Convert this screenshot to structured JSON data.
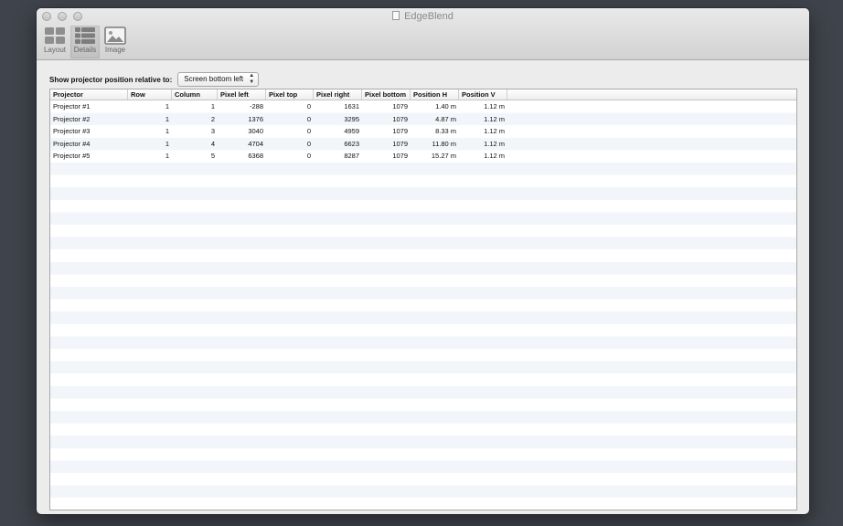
{
  "window": {
    "title": "EdgeBlend"
  },
  "toolbar": {
    "items": [
      {
        "label": "Layout",
        "icon": "layout-grid-icon"
      },
      {
        "label": "Details",
        "icon": "details-list-icon"
      },
      {
        "label": "Image",
        "icon": "image-icon"
      }
    ]
  },
  "relative": {
    "label": "Show projector position relative to:",
    "selected": "Screen bottom left"
  },
  "table": {
    "columns": [
      "Projector",
      "Row",
      "Column",
      "Pixel left",
      "Pixel top",
      "Pixel right",
      "Pixel bottom",
      "Position H",
      "Position V"
    ],
    "rows": [
      [
        "Projector #1",
        "1",
        "1",
        "-288",
        "0",
        "1631",
        "1079",
        "1.40 m",
        "1.12 m"
      ],
      [
        "Projector #2",
        "1",
        "2",
        "1376",
        "0",
        "3295",
        "1079",
        "4.87 m",
        "1.12 m"
      ],
      [
        "Projector #3",
        "1",
        "3",
        "3040",
        "0",
        "4959",
        "1079",
        "8.33 m",
        "1.12 m"
      ],
      [
        "Projector #4",
        "1",
        "4",
        "4704",
        "0",
        "6623",
        "1079",
        "11.80 m",
        "1.12 m"
      ],
      [
        "Projector #5",
        "1",
        "5",
        "6368",
        "0",
        "8287",
        "1079",
        "15.27 m",
        "1.12 m"
      ]
    ]
  }
}
